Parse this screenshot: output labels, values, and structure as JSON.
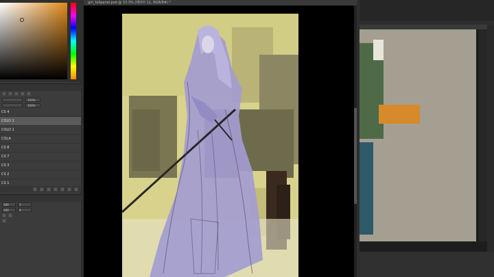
{
  "left_panel": {
    "layers": [
      {
        "label": "CS 4"
      },
      {
        "label": "COLO 1",
        "selected": true
      },
      {
        "label": "COLO 1"
      },
      {
        "label": "COLA"
      },
      {
        "label": "CS 8"
      },
      {
        "label": "CS 7"
      },
      {
        "label": "CS 3"
      },
      {
        "label": "CS 2"
      },
      {
        "label": "CS 1"
      }
    ],
    "props": {
      "opacity": "100%",
      "blend": "100%"
    },
    "tool_fields": [
      "100",
      "1",
      "100",
      "0"
    ]
  },
  "canvas": {
    "title": "girl_fullpanel.psd @ 33.3% (레이어 11, RGB/8#) *"
  },
  "colors": {
    "canvas_bg": "#d9d48a",
    "figure_fill": "#a29bd0",
    "sword": "#2a2a2a",
    "dark_block": "#6c6a4a",
    "ref_bg": "#a59f92",
    "ref_green": "#4f6a47",
    "ref_orange": "#d68a2c",
    "ref_teal": "#2e5a6a"
  }
}
